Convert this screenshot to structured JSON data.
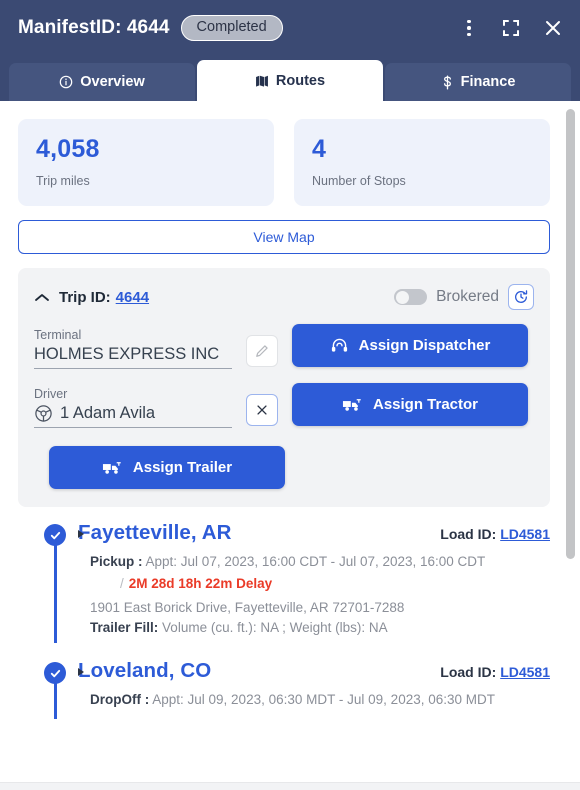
{
  "header": {
    "title": "ManifestID: 4644",
    "status": "Completed",
    "actions": [
      {
        "name": "more-options-icon",
        "label": "More options"
      },
      {
        "name": "fullscreen-icon",
        "label": "Fullscreen"
      },
      {
        "name": "close-icon",
        "label": "Close"
      }
    ],
    "colors": {
      "background": "#3b4a73",
      "badge": "#b3b8c4"
    }
  },
  "tabs": [
    {
      "label": "Overview",
      "icon": "info-icon",
      "active": false
    },
    {
      "label": "Routes",
      "icon": "map-icon",
      "active": true
    },
    {
      "label": "Finance",
      "icon": "dollar-icon",
      "active": false
    }
  ],
  "stats": [
    {
      "value": "4,058",
      "label": "Trip miles"
    },
    {
      "value": "4",
      "label": "Number of Stops"
    }
  ],
  "view_map_label": "View Map",
  "trip": {
    "id_label": "Trip ID:",
    "id_value": "4644",
    "brokered_label": "Brokered",
    "brokered_on": false,
    "history_icon": "history-refresh-icon",
    "terminal": {
      "label": "Terminal",
      "value": "HOLMES EXPRESS INC",
      "edit_icon": "pencil-icon"
    },
    "driver": {
      "label": "Driver",
      "value": "1 Adam Avila",
      "icon": "steering-wheel-icon",
      "clear_icon": "close-icon"
    },
    "buttons": [
      {
        "label": "Assign Dispatcher",
        "icon": "headset-icon"
      },
      {
        "label": "Assign Tractor",
        "icon": "truck-icon"
      },
      {
        "label": "Assign Trailer",
        "icon": "truck-icon"
      }
    ]
  },
  "stops": [
    {
      "name": "Fayetteville, AR",
      "load_id_label": "Load ID:",
      "load_id_value": "LD4581",
      "type_label": "Pickup :",
      "appt": "Appt: Jul 07, 2023, 16:00 CDT",
      "dash": "-",
      "appt_end": "Jul 07, 2023, 16:00 CDT",
      "delay": "2M 28d 18h 22m Delay",
      "address": "1901 East Borick Drive, Fayetteville, AR 72701-7288",
      "trailer_fill_label": "Trailer Fill:",
      "trailer_fill_value": "Volume (cu. ft.): NA ; Weight (lbs): NA"
    },
    {
      "name": "Loveland, CO",
      "load_id_label": "Load ID:",
      "load_id_value": "LD4581",
      "type_label": "DropOff :",
      "appt": "Appt: Jul 09, 2023, 06:30 MDT",
      "dash": "-",
      "appt_end": "Jul 09, 2023, 06:30 MDT"
    }
  ],
  "colors": {
    "primary": "#2d5bd7",
    "header": "#3b4a73",
    "panel": "#f2f3f5",
    "stat_card": "#eef2fb",
    "delay": "#ea3b28"
  }
}
